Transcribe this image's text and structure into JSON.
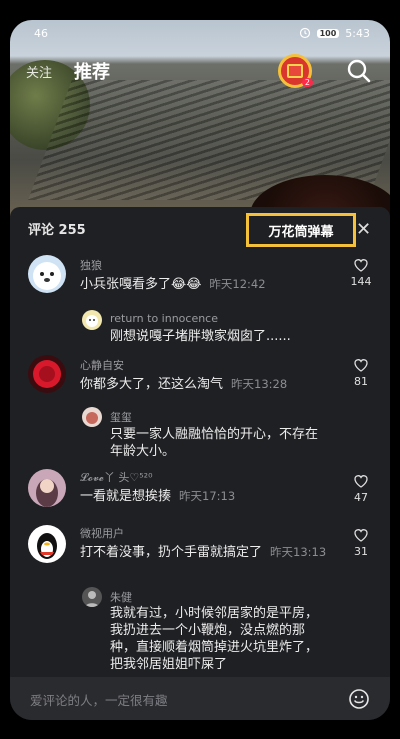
{
  "status_bar": {
    "signal": "46",
    "battery": "100",
    "time": "5:43"
  },
  "top_nav": {
    "follow": "关注",
    "recommend": "推荐",
    "gift_count": "2"
  },
  "panel": {
    "comment_count": "评论 255",
    "kaleidoscope_label": "万花筒弹幕",
    "close": "✕",
    "input_placeholder": "爱评论的人，一定很有趣"
  },
  "comments": [
    {
      "user": "独狼",
      "text": "小兵张嘎看多了😂😂",
      "time": "昨天12:42",
      "likes": "144",
      "reply": {
        "user": "return to innocence",
        "text": "刚想说嘎子堵胖墩家烟囱了......"
      }
    },
    {
      "user": "心静自安",
      "text": "你都多大了，还这么淘气",
      "time": "昨天13:28",
      "likes": "81",
      "reply": {
        "user": "玺玺",
        "text": "只要一家人融融恰恰的开心，不存在年龄大小。"
      }
    },
    {
      "user": "𝓛𝓸𝓿𝓮丫 头♡⁵²⁰",
      "text": "一看就是想挨揍",
      "time": "昨天17:13",
      "likes": "47"
    },
    {
      "user": "微视用户",
      "text": "打不着没事，扔个手雷就搞定了",
      "time": "昨天13:13",
      "likes": "31",
      "reply": {
        "user": "朱健",
        "text": "我就有过，小时候邻居家的是平房，我扔进去一个小鞭炮，没点燃的那种，直接顺着烟筒掉进火坑里炸了，把我邻居姐姐吓屎了"
      }
    }
  ]
}
